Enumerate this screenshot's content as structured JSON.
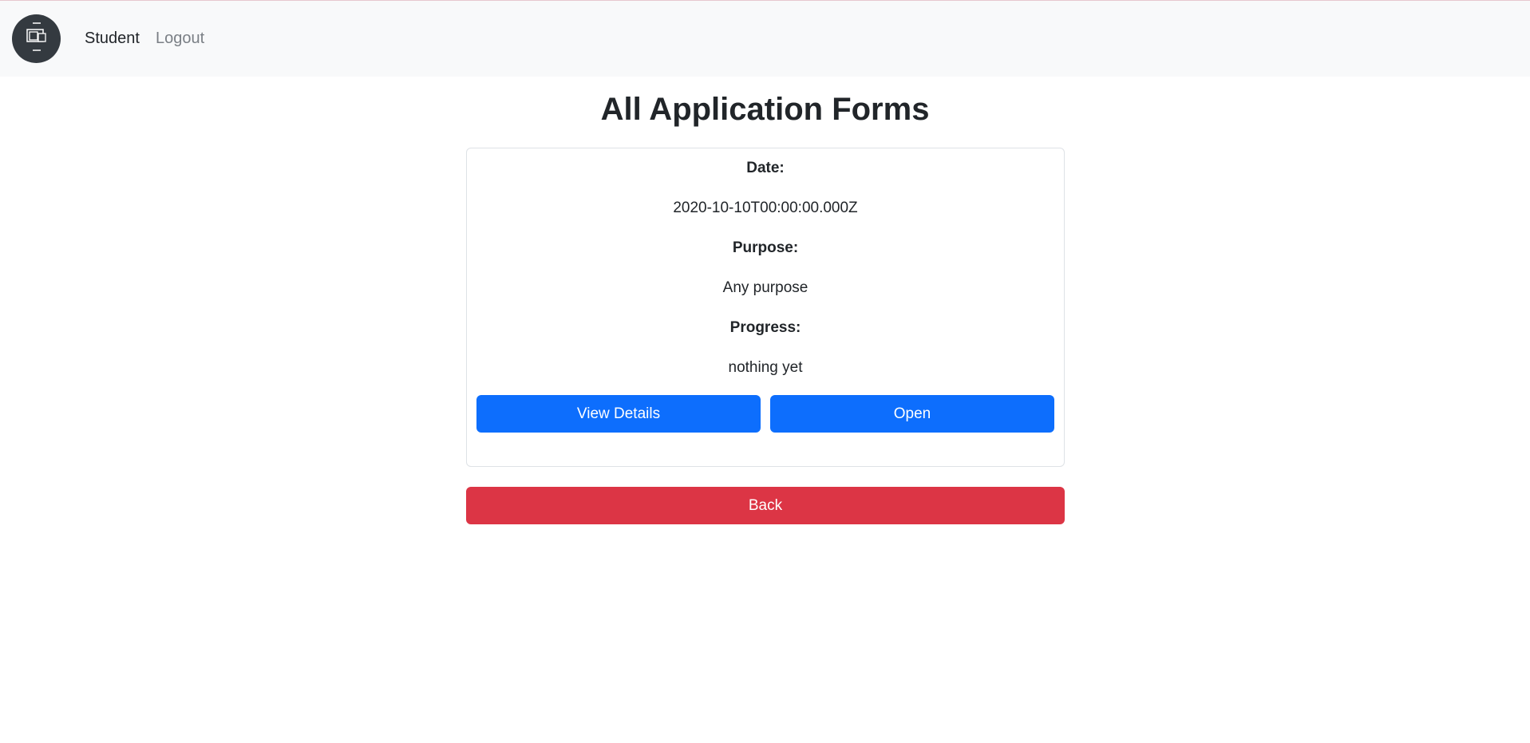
{
  "navbar": {
    "logo_icon": "responsive-devices-icon",
    "links": [
      {
        "label": "Student"
      },
      {
        "label": "Logout"
      }
    ]
  },
  "page": {
    "title": "All Application Forms"
  },
  "form": {
    "date_label": "Date:",
    "date_value": "2020-10-10T00:00:00.000Z",
    "purpose_label": "Purpose:",
    "purpose_value": "Any purpose",
    "progress_label": "Progress:",
    "progress_value": "nothing yet",
    "view_details_label": "View Details",
    "open_label": "Open"
  },
  "actions": {
    "back_label": "Back"
  },
  "colors": {
    "primary": "#0d6efd",
    "danger": "#dc3545",
    "navbar_bg": "#f8f9fa",
    "logo_bg": "#343a40"
  }
}
